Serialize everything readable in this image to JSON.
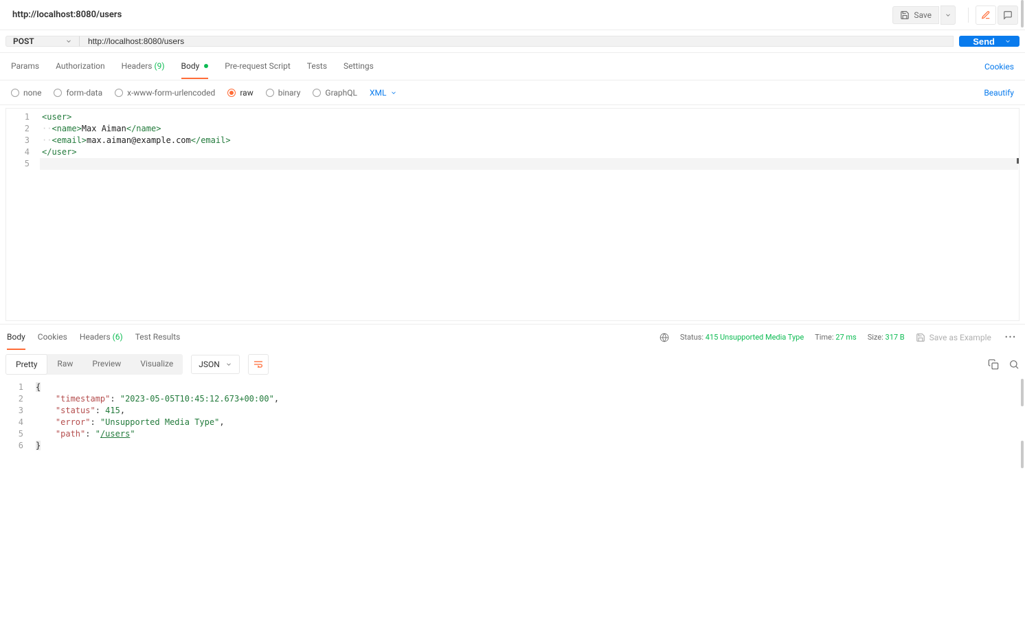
{
  "tabTitle": "http://localhost:8080/users",
  "topbar": {
    "save": "Save"
  },
  "req": {
    "method": "POST",
    "url": "http://localhost:8080/users",
    "send": "Send"
  },
  "reqTabs": {
    "params": "Params",
    "auth": "Authorization",
    "headers": "Headers",
    "headersCount": "(9)",
    "body": "Body",
    "pre": "Pre-request Script",
    "tests": "Tests",
    "settings": "Settings",
    "cookies": "Cookies"
  },
  "bodyTypes": {
    "none": "none",
    "form": "form-data",
    "url": "x-www-form-urlencoded",
    "raw": "raw",
    "binary": "binary",
    "graphql": "GraphQL",
    "rawLang": "XML",
    "beautify": "Beautify"
  },
  "bodyLines": [
    "<user>",
    "  <name>Max Aiman</name>",
    "  <email>max.aiman@example.com</email>",
    "</user>",
    ""
  ],
  "respTabs": {
    "body": "Body",
    "cookies": "Cookies",
    "headers": "Headers",
    "headersCount": "(6)",
    "test": "Test Results"
  },
  "respMeta": {
    "statusLbl": "Status:",
    "status": "415 Unsupported Media Type",
    "timeLbl": "Time:",
    "time": "27 ms",
    "sizeLbl": "Size:",
    "size": "317 B",
    "saveEx": "Save as Example"
  },
  "respView": {
    "pretty": "Pretty",
    "raw": "Raw",
    "preview": "Preview",
    "visualize": "Visualize",
    "format": "JSON"
  },
  "resp": {
    "timestampKey": "\"timestamp\"",
    "timestampVal": "\"2023-05-05T10:45:12.673+00:00\"",
    "statusKey": "\"status\"",
    "statusVal": "415",
    "errorKey": "\"error\"",
    "errorVal": "\"Unsupported Media Type\"",
    "pathKey": "\"path\"",
    "pathVal": "\"/users\""
  },
  "lineNums": {
    "l1": "1",
    "l2": "2",
    "l3": "3",
    "l4": "4",
    "l5": "5",
    "l6": "6"
  }
}
